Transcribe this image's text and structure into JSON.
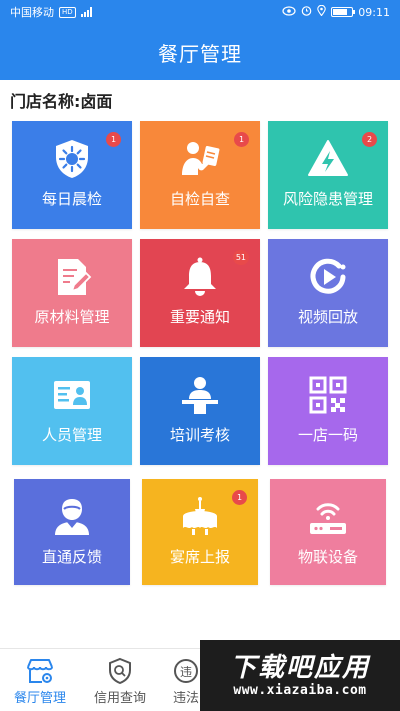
{
  "status_bar": {
    "carrier": "中国移动",
    "hd": "HD",
    "time": "09:11"
  },
  "header": {
    "title": "餐厅管理"
  },
  "store": {
    "label": "门店名称:卤面"
  },
  "tiles": [
    {
      "label": "每日晨检",
      "color": "#3b7ee8",
      "icon": "virus-shield-icon",
      "badge": "1"
    },
    {
      "label": "自检自查",
      "color": "#f8883a",
      "icon": "person-checklist-icon",
      "badge": "1"
    },
    {
      "label": "风险隐患管理",
      "color": "#2fc4ae",
      "icon": "warning-lightning-icon",
      "badge": "2"
    },
    {
      "label": "原材料管理",
      "color": "#ef7b8c",
      "icon": "document-edit-icon",
      "badge": ""
    },
    {
      "label": "重要通知",
      "color": "#e24552",
      "icon": "bell-icon",
      "badge": "51"
    },
    {
      "label": "视频回放",
      "color": "#6b76e0",
      "icon": "replay-icon",
      "badge": ""
    },
    {
      "label": "人员管理",
      "color": "#52c0ef",
      "icon": "id-card-icon",
      "badge": ""
    },
    {
      "label": "培训考核",
      "color": "#2976d8",
      "icon": "lecturer-icon",
      "badge": ""
    },
    {
      "label": "一店一码",
      "color": "#a668ec",
      "icon": "qr-code-icon",
      "badge": ""
    },
    {
      "label": "直通反馈",
      "color": "#5a6fdc",
      "icon": "user-feedback-icon",
      "badge": ""
    },
    {
      "label": "宴席上报",
      "color": "#f6b41f",
      "icon": "banquet-table-icon",
      "badge": "1"
    },
    {
      "label": "物联设备",
      "color": "#ef7e9e",
      "icon": "router-icon",
      "badge": ""
    }
  ],
  "bottom_nav": [
    {
      "label": "餐厅管理",
      "icon": "store-gear-icon",
      "active": true
    },
    {
      "label": "信用查询",
      "icon": "shield-search-icon",
      "active": false
    },
    {
      "label": "违法",
      "icon": "violation-icon",
      "active": false
    }
  ],
  "watermark": {
    "title": "下载吧应用",
    "url": "www.xiazaiba.com"
  },
  "colors": {
    "primary": "#2a86ec",
    "active_nav": "#2a86ec",
    "inactive_nav": "#555555",
    "badge": "#e84a4a"
  }
}
